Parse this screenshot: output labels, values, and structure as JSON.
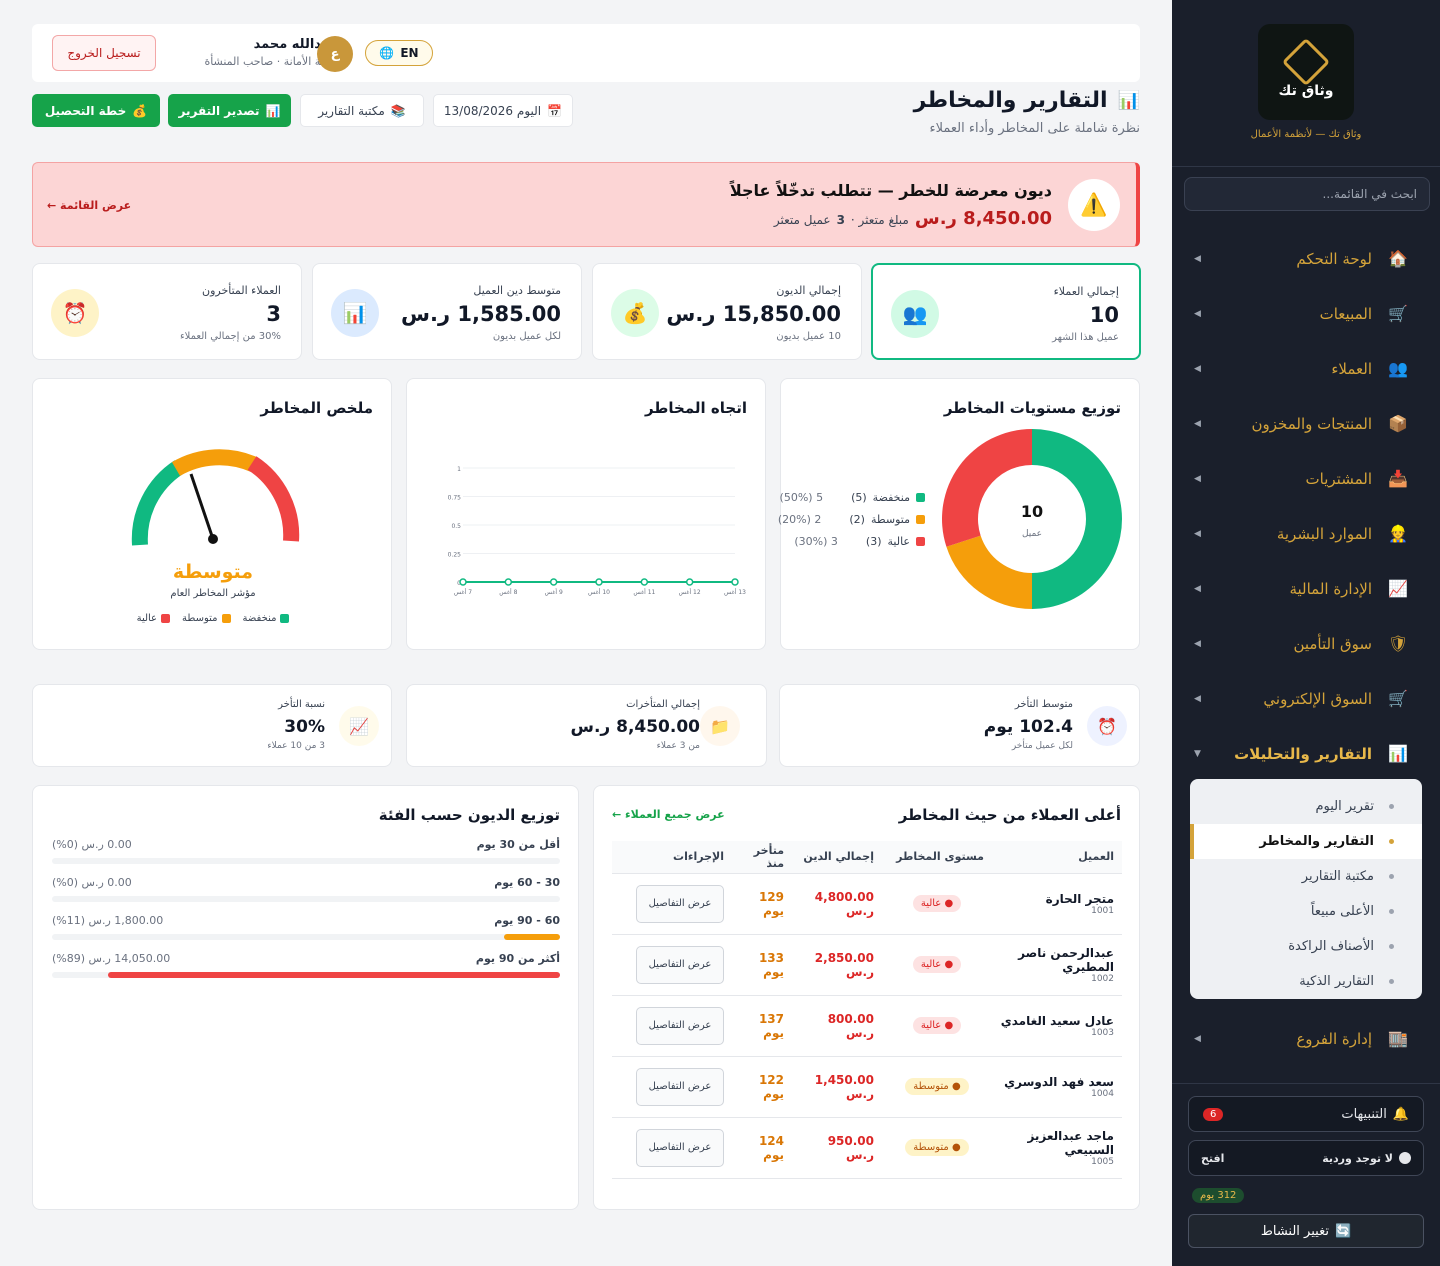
{
  "brand": {
    "logo_text": "وثاق تك",
    "tagline": "وثاق تك — لأنظمة الأعمال"
  },
  "sidebar": {
    "search_placeholder": "ابحث في القائمة...",
    "items": [
      {
        "label": "لوحة التحكم",
        "icon": "home-icon",
        "glyph": "🏠"
      },
      {
        "label": "المبيعات",
        "icon": "cart-icon",
        "glyph": "🛒"
      },
      {
        "label": "العملاء",
        "icon": "users-icon",
        "glyph": "👥"
      },
      {
        "label": "المنتجات والمخزون",
        "icon": "box-icon",
        "glyph": "📦"
      },
      {
        "label": "المشتريات",
        "icon": "inbox-icon",
        "glyph": "📥"
      },
      {
        "label": "الموارد البشرية",
        "icon": "person-icon",
        "glyph": "👷"
      },
      {
        "label": "الإدارة المالية",
        "icon": "chart-up-icon",
        "glyph": "📈"
      },
      {
        "label": "سوق التأمين",
        "icon": "shield-icon",
        "glyph": "🛡"
      },
      {
        "label": "السوق الإلكتروني",
        "icon": "cart-icon",
        "glyph": "🛒"
      },
      {
        "label": "التقارير والتحليلات",
        "icon": "bar-chart-icon",
        "glyph": "📊"
      }
    ],
    "subitems": [
      "تقرير اليوم",
      "التقارير والمخاطر",
      "مكتبة التقارير",
      "الأعلى مبيعاً",
      "الأصناف الراكدة",
      "التقارير الذكية"
    ],
    "branches": {
      "label": "إدارة الفروع",
      "glyph": "🏬"
    },
    "alerts_label": "التنبيهات",
    "alerts_count": "6",
    "shift_label": "لا توجد وردية",
    "shift_open": "افتح",
    "days": "312 يوم",
    "change_activity": "تغيير النشاط"
  },
  "topbar": {
    "logout": "تسجيل الخروج",
    "user_name": "عبدالله محمد",
    "user_sub": "بقالة الأمانة · صاحب المنشأة",
    "avatar": "ع",
    "lang": "EN"
  },
  "header": {
    "title": "التقارير والمخاطر",
    "subtitle": "نظرة شاملة على المخاطر وأداء العملاء",
    "date": "اليوم 13/08/2026",
    "library": "مكتبة التقارير",
    "export": "تصدير التقرير",
    "collection": "خطة التحصيل"
  },
  "alert": {
    "title": "ديون معرضة للخطر — تتطلب تدخّلاً عاجلاً",
    "amount": "8,450.00 ر.س",
    "desc_pre": "مبلغ متعثر ·",
    "desc_num": "3",
    "desc_post": "عميل متعثر",
    "link": "عرض القائمة ←"
  },
  "kpis": [
    {
      "label": "إجمالي العملاء",
      "value": "10",
      "sub": "عميل هذا الشهر",
      "glyph": "👥",
      "bg": "#d1fae5"
    },
    {
      "label": "إجمالي الديون",
      "value": "15,850.00 ر.س",
      "sub": "10 عميل بديون",
      "glyph": "💰",
      "bg": "#dcfce7"
    },
    {
      "label": "متوسط دين العميل",
      "value": "1,585.00 ر.س",
      "sub": "لكل عميل بديون",
      "glyph": "📊",
      "bg": "#dbeafe"
    },
    {
      "label": "العملاء المتأخرون",
      "value": "3",
      "sub": "30% من إجمالي العملاء",
      "glyph": "⏰",
      "bg": "#fef3c7"
    }
  ],
  "risk_dist": {
    "title": "توزيع مستويات المخاطر",
    "center_value": "10",
    "center_label": "عميل",
    "legend": [
      {
        "label": "منخفضة",
        "count": "(5)",
        "pct": "5 (50%)",
        "color": "#10b981",
        "value": 5
      },
      {
        "label": "متوسطة",
        "count": "(2)",
        "pct": "2 (20%)",
        "color": "#f59e0b",
        "value": 2
      },
      {
        "label": "عالية",
        "count": "(3)",
        "pct": "3 (30%)",
        "color": "#ef4444",
        "value": 3
      }
    ]
  },
  "trend": {
    "title": "اتجاه المخاطر"
  },
  "chart_data": {
    "type": "line",
    "x": [
      "7 أغس",
      "8 أغس",
      "9 أغس",
      "10 أغس",
      "11 أغس",
      "12 أغس",
      "13 أغس"
    ],
    "series": [
      {
        "values": [
          0,
          0,
          0,
          0,
          0,
          0,
          0
        ],
        "color": "#10b981"
      }
    ],
    "yticks": [
      "0",
      "0.25",
      "0.5",
      "0.75",
      "1"
    ],
    "ylim": [
      0,
      1
    ]
  },
  "gauge": {
    "title": "ملخص المخاطر",
    "level": "متوسطة",
    "subtitle": "مؤشر المخاطر العام",
    "legend": [
      {
        "label": "منخفضة",
        "color": "#10b981"
      },
      {
        "label": "متوسطة",
        "color": "#f59e0b"
      },
      {
        "label": "عالية",
        "color": "#ef4444"
      }
    ]
  },
  "stats": [
    {
      "label": "متوسط التأخر",
      "value": "102.4 يوم",
      "sub": "لكل عميل متأخر",
      "glyph": "⏰",
      "bg": "#eef2ff"
    },
    {
      "label": "إجمالي المتأخرات",
      "value": "8,450.00 ر.س",
      "sub": "من 3 عملاء",
      "glyph": "📁",
      "bg": "#fff7ed"
    },
    {
      "label": "نسبة التأخر",
      "value": "30%",
      "sub": "3 من 10 عملاء",
      "glyph": "📈",
      "bg": "#fffbeb"
    }
  ],
  "top_customers": {
    "title": "أعلى العملاء من حيث المخاطر",
    "link": "عرض جميع العملاء ←",
    "headers": [
      "العميل",
      "مستوى المخاطر",
      "إجمالي الدين",
      "متأخر منذ",
      "الإجراءات"
    ],
    "rows": [
      {
        "name": "متجر الحارة",
        "id": "1001",
        "risk": "● عالية",
        "level": "high",
        "debt": "4,800.00 ر.س",
        "late": "129 يوم"
      },
      {
        "name": "عبدالرحمن ناصر المطيري",
        "id": "1002",
        "risk": "● عالية",
        "level": "high",
        "debt": "2,850.00 ر.س",
        "late": "133 يوم"
      },
      {
        "name": "عادل سعيد الغامدي",
        "id": "1003",
        "risk": "● عالية",
        "level": "high",
        "debt": "800.00 ر.س",
        "late": "137 يوم"
      },
      {
        "name": "سعد فهد الدوسري",
        "id": "1004",
        "risk": "● متوسطة",
        "level": "mid",
        "debt": "1,450.00 ر.س",
        "late": "122 يوم"
      },
      {
        "name": "ماجد عبدالعزيز السبيعي",
        "id": "1005",
        "risk": "● متوسطة",
        "level": "mid",
        "debt": "950.00 ر.س",
        "late": "124 يوم"
      }
    ],
    "action": "عرض التفاصيل"
  },
  "debt_dist": {
    "title": "توزيع الديون حسب الفئة",
    "rows": [
      {
        "label": "أقل من 30 يوم",
        "amount": "0.00 ر.س (0%)",
        "pct": 0,
        "color": "#10b981"
      },
      {
        "label": "30 - 60 يوم",
        "amount": "0.00 ر.س (0%)",
        "pct": 0,
        "color": "#10b981"
      },
      {
        "label": "60 - 90 يوم",
        "amount": "1,800.00 ر.س (11%)",
        "pct": 11,
        "color": "#f59e0b"
      },
      {
        "label": "أكثر من 90 يوم",
        "amount": "14,050.00 ر.س (89%)",
        "pct": 89,
        "color": "#ef4444"
      }
    ]
  }
}
